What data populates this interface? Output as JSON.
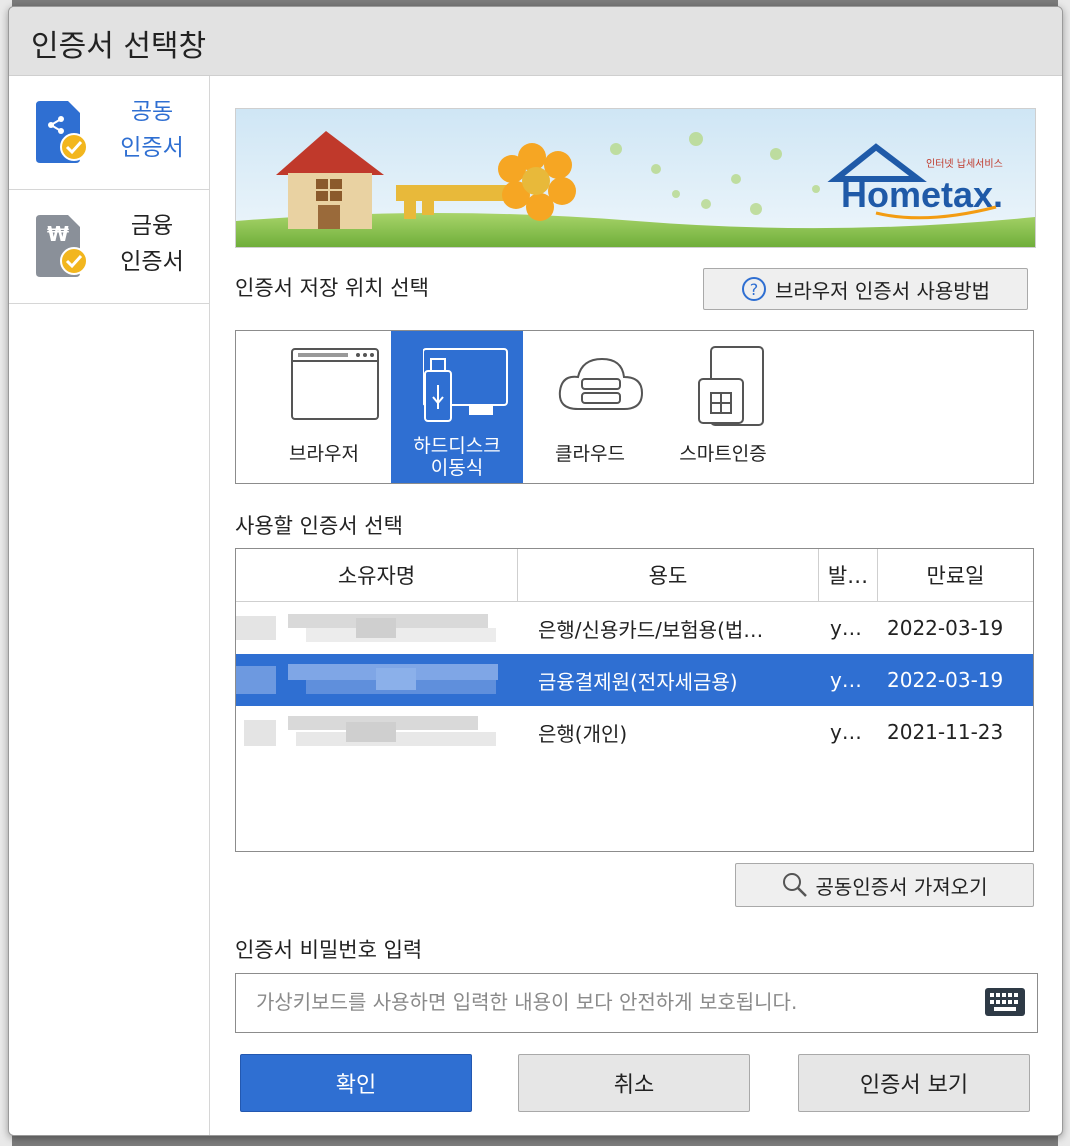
{
  "dialog": {
    "title": "인증서 선택창"
  },
  "sidebar": {
    "items": [
      {
        "line1": "공동",
        "line2": "인증서",
        "active": true
      },
      {
        "line1": "금융",
        "line2": "인증서",
        "active": false
      }
    ],
    "finance_symbol": "₩"
  },
  "banner": {
    "logo_small": "인터넷 납세서비스",
    "logo_text": "Hometax."
  },
  "storage": {
    "label": "인증서 저장 위치 선택",
    "help_button": "브라우저 인증서 사용방법",
    "options": [
      {
        "label": "브라우저",
        "icon": "browser-icon"
      },
      {
        "label_line1": "하드디스크",
        "label_line2": "이동식",
        "icon": "usb-drive-icon",
        "selected": true
      },
      {
        "label": "클라우드",
        "icon": "cloud-icon"
      },
      {
        "label": "스마트인증",
        "icon": "smartphone-icon"
      }
    ]
  },
  "certificates": {
    "label": "사용할 인증서 선택",
    "columns": [
      "소유자명",
      "용도",
      "발…",
      "만료일"
    ],
    "rows": [
      {
        "owner": "",
        "usage": "은행/신용카드/보험용(법…",
        "issuer": "y…",
        "expiry": "2022-03-19",
        "selected": false
      },
      {
        "owner": "",
        "usage": "금융결제원(전자세금용)",
        "issuer": "y…",
        "expiry": "2022-03-19",
        "selected": true
      },
      {
        "owner": "",
        "usage": "은행(개인)",
        "issuer": "y…",
        "expiry": "2021-11-23",
        "selected": false
      }
    ],
    "import_button": "공동인증서 가져오기"
  },
  "password": {
    "label": "인증서 비밀번호 입력",
    "placeholder": "가상키보드를 사용하면 입력한 내용이 보다 안전하게 보호됩니다.",
    "value": ""
  },
  "buttons": {
    "ok": "확인",
    "cancel": "취소",
    "view": "인증서 보기"
  },
  "colors": {
    "accent": "#2f6fd2",
    "title_bar": "#e2e2e2",
    "badge": "#f2b61e"
  }
}
